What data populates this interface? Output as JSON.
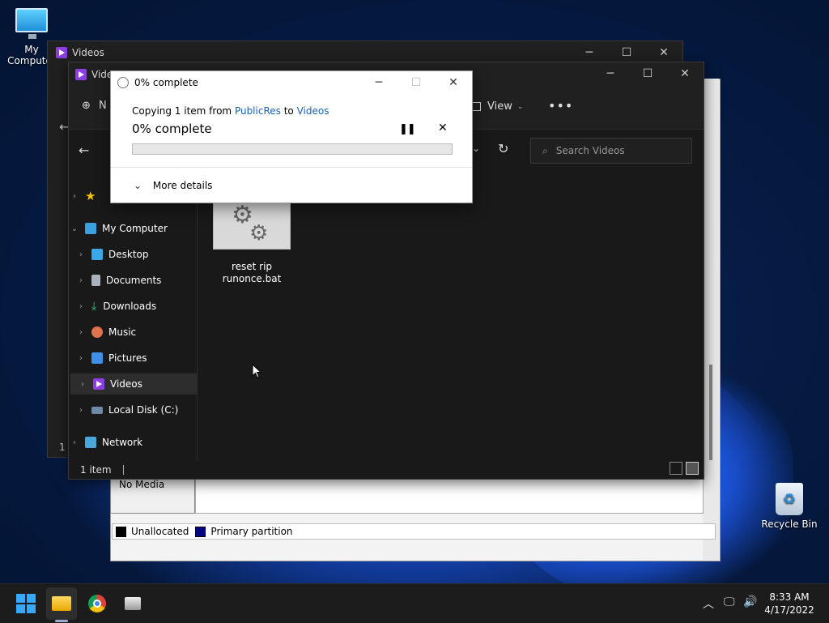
{
  "desktop": {
    "my_computer_label": "My Computer",
    "recycle_bin_label": "Recycle Bin"
  },
  "disk_mgmt": {
    "no_media": "No Media",
    "legend": [
      {
        "label": "Unallocated",
        "color": "#000000"
      },
      {
        "label": "Primary partition",
        "color": "#000080"
      }
    ]
  },
  "back_window": {
    "title": "Videos",
    "status_fragment": "1 i"
  },
  "explorer": {
    "title": "Videos",
    "new_label": "N",
    "view_label": "View",
    "search_placeholder": "Search Videos",
    "nav": [
      {
        "label": "",
        "icon": "star-icon"
      },
      {
        "label": "My Computer",
        "icon": "monitor-icon",
        "expanded": true
      },
      {
        "label": "Desktop",
        "icon": "desktop-icon"
      },
      {
        "label": "Documents",
        "icon": "document-icon"
      },
      {
        "label": "Downloads",
        "icon": "download-icon"
      },
      {
        "label": "Music",
        "icon": "music-icon"
      },
      {
        "label": "Pictures",
        "icon": "picture-icon"
      },
      {
        "label": "Videos",
        "icon": "video-icon",
        "selected": true
      },
      {
        "label": "Local Disk (C:)",
        "icon": "disk-icon"
      },
      {
        "label": "Network",
        "icon": "network-icon"
      }
    ],
    "files": [
      {
        "name_line1": "reset rip",
        "name_line2": "runonce.bat",
        "icon": "batch-file-icon"
      }
    ],
    "status": "1 item"
  },
  "copy_dialog": {
    "title": "0% complete",
    "copying_prefix": "Copying 1 item from ",
    "source": "PublicRes",
    "to_word": " to ",
    "destination": "Videos",
    "percent_text": "0% complete",
    "progress": 0,
    "more_details": "More details",
    "progress_color": "#06b025"
  },
  "taskbar": {
    "time": "8:33 AM",
    "date": "4/17/2022",
    "apps": [
      "start-icon",
      "file-explorer-icon",
      "chrome-icon",
      "setup-icon"
    ]
  }
}
